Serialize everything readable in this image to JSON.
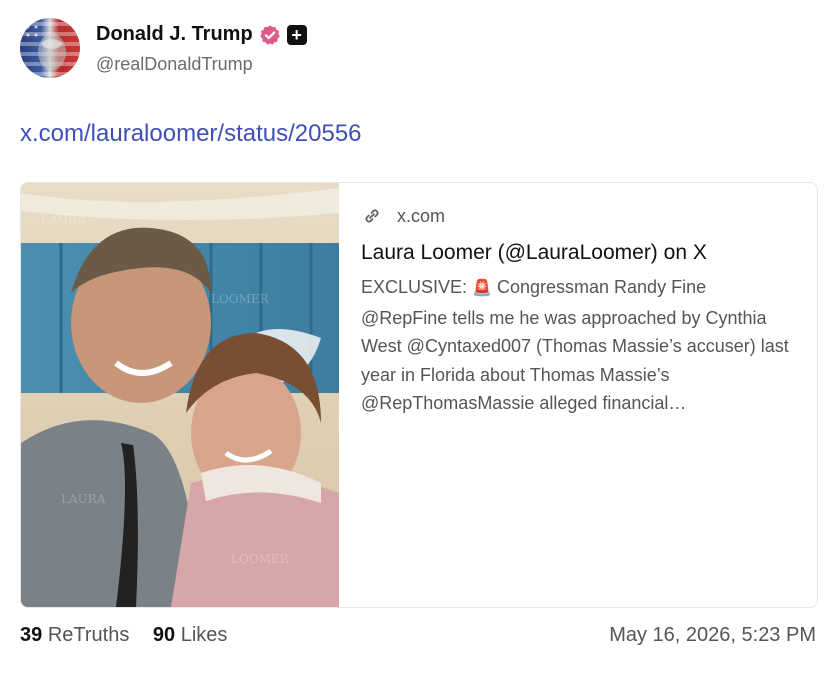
{
  "post": {
    "author": {
      "display_name": "Donald J. Trump",
      "handle": "@realDonaldTrump",
      "badges": [
        "verified-badge-icon",
        "plus-badge-icon"
      ]
    },
    "link_text": "x.com/lauraloomer/status/20556",
    "preview": {
      "domain": "x.com",
      "title": "Laura Loomer (@LauraLoomer) on X",
      "description_prefix": "EXCLUSIVE: ",
      "description_icon": "siren-icon",
      "description": "Congressman Randy Fine @RepFine tells me he was approached by Cynthia West @Cyntaxed007 (Thomas Massie’s accuser) last year in Florida about Thomas Massie’s @RepThomasMassie alleged financial…",
      "image_description": "selfie photo"
    },
    "stats": {
      "retruths_count": "39",
      "retruths_label": "ReTruths",
      "likes_count": "90",
      "likes_label": "Likes"
    },
    "timestamp": "May 16, 2026, 5:23 PM"
  },
  "colors": {
    "link": "#3f4fb8",
    "verified": "#e05a8c",
    "muted": "#555555"
  }
}
